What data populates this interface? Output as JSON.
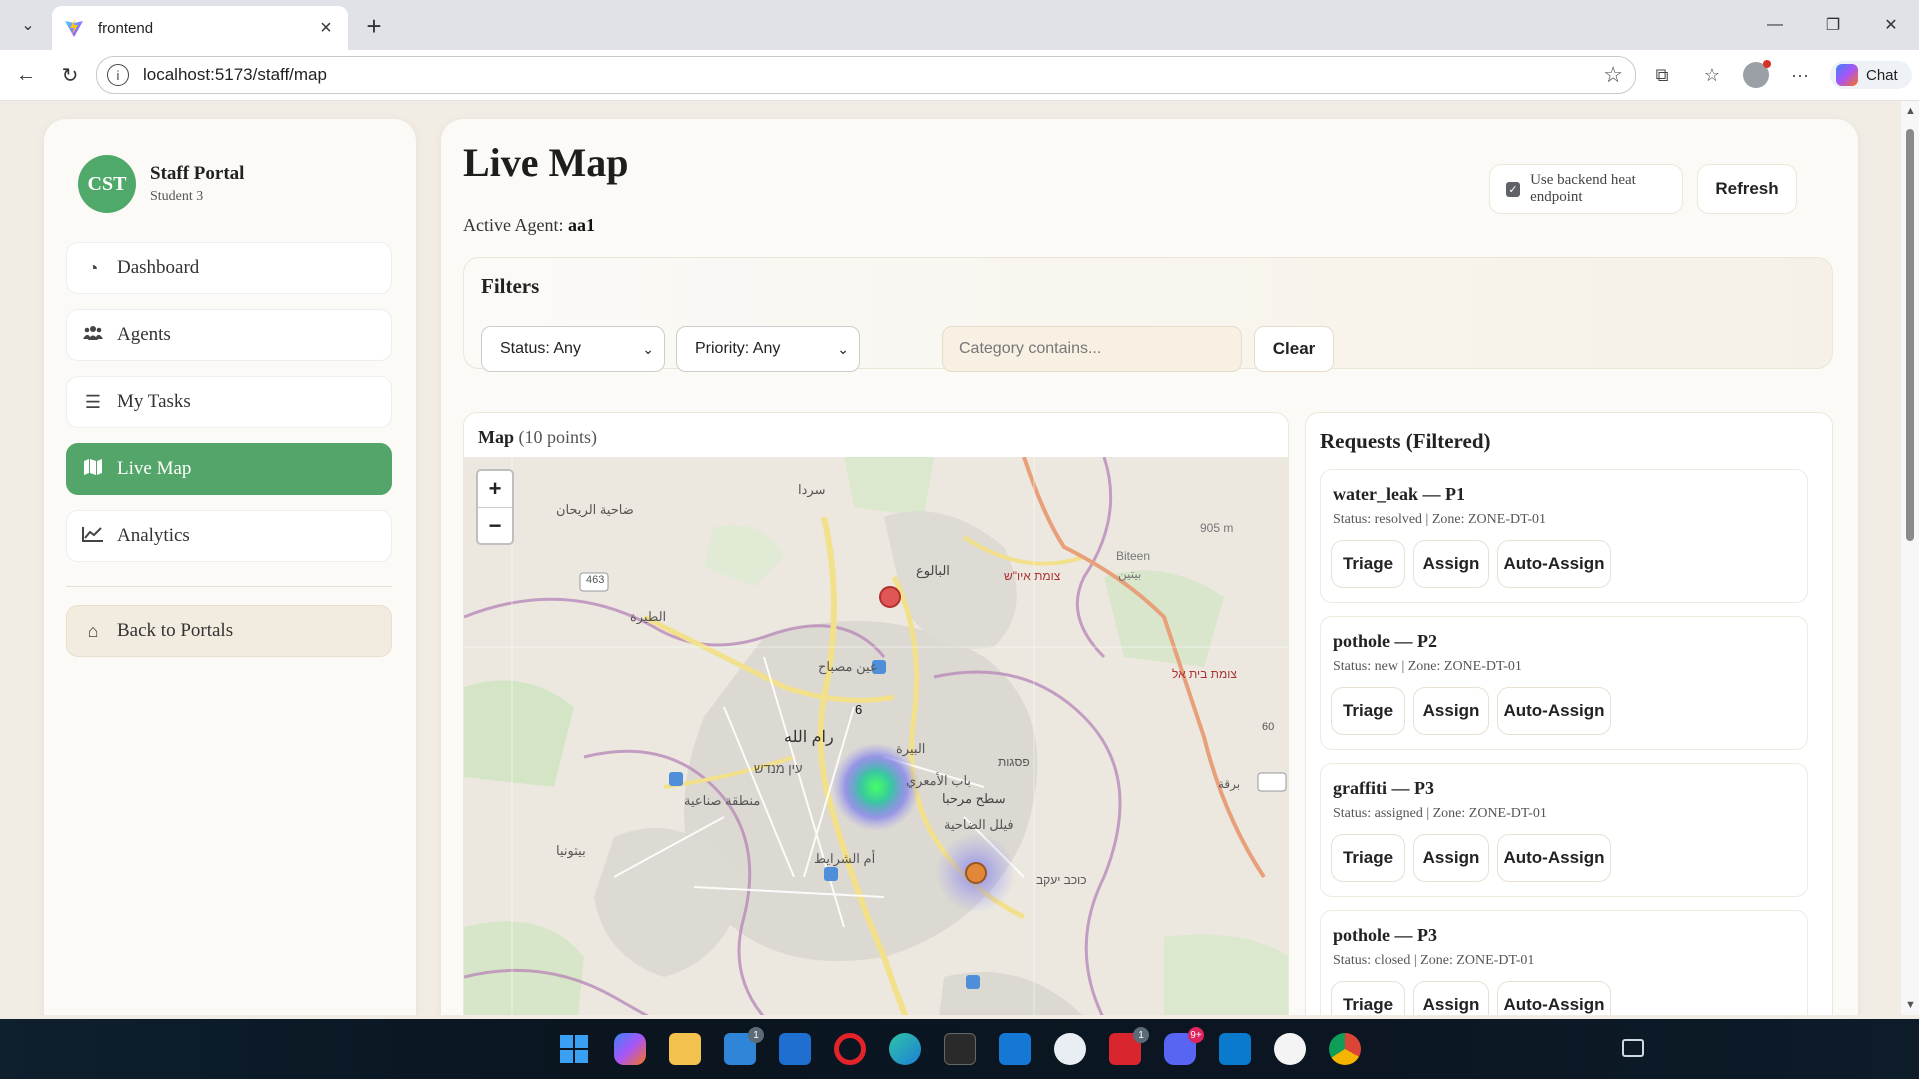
{
  "browser": {
    "tab_title": "frontend",
    "url": "localhost:5173/staff/map",
    "chat_label": "Chat"
  },
  "sidebar": {
    "brand_logo": "CST",
    "brand_title": "Staff Portal",
    "brand_sub": "Student 3",
    "items": [
      {
        "label": "Dashboard",
        "icon": "dashboard-icon"
      },
      {
        "label": "Agents",
        "icon": "users-icon"
      },
      {
        "label": "My Tasks",
        "icon": "list-icon"
      },
      {
        "label": "Live Map",
        "icon": "map-icon",
        "active": true
      },
      {
        "label": "Analytics",
        "icon": "chart-line-icon"
      }
    ],
    "back_label": "Back to Portals"
  },
  "main": {
    "title": "Live Map",
    "agent_label": "Active Agent:",
    "agent_value": "aa1",
    "heat_toggle_label": "Use backend heat endpoint",
    "heat_toggle_checked": true,
    "refresh_label": "Refresh"
  },
  "filters": {
    "title": "Filters",
    "status_value": "Status: Any",
    "priority_value": "Priority: Any",
    "category_placeholder": "Category contains...",
    "clear_label": "Clear"
  },
  "map": {
    "title": "Map",
    "count": "(10 points)",
    "cluster_count": "6",
    "zoom_in": "+",
    "zoom_out": "−",
    "labels": {
      "l1": "سردا",
      "l2": "ضاحية الريحان",
      "l3": "البالوع",
      "l4": "צומת איו\"ש",
      "l5": "Biteen",
      "l6": "بيتين",
      "l7": "905 m",
      "l8": "463",
      "l9": "الطيرة",
      "l10": "عين مصباح",
      "l11": "צומת בית אל",
      "l12": "رام الله",
      "l13": "البيرة",
      "l14": "עין מנדש",
      "l15": "باب الأمعري",
      "l16": "פסגות",
      "l17": "منطقة صناعية",
      "l18": "فيلل الضاحية",
      "l19": "بيتونيا",
      "l20": "أم الشرايط",
      "l21": "כוכב יעקב",
      "l22": "60",
      "l23": "برقة",
      "l24": "سطح مرحبا"
    }
  },
  "requests": {
    "title": "Requests (Filtered)",
    "actions": [
      "Triage",
      "Assign",
      "Auto-Assign"
    ],
    "items": [
      {
        "name": "water_leak — P1",
        "meta": "Status: resolved | Zone: ZONE-DT-01"
      },
      {
        "name": "pothole — P2",
        "meta": "Status: new | Zone: ZONE-DT-01"
      },
      {
        "name": "graffiti — P3",
        "meta": "Status: assigned | Zone: ZONE-DT-01"
      },
      {
        "name": "pothole — P3",
        "meta": "Status: closed | Zone: ZONE-DT-01"
      }
    ]
  },
  "taskbar": {
    "apps": [
      "windows-start-icon",
      "copilot-icon",
      "file-explorer-icon",
      "mail-icon",
      "store-icon",
      "opera-icon",
      "edge-icon",
      "epic-games-icon",
      "outlook-icon",
      "app-icon",
      "l-app-icon",
      "discord-icon",
      "vscode-icon",
      "kaspersky-icon",
      "chrome-icon"
    ],
    "badges": {
      "mail": "1",
      "l_app": "1",
      "discord": "9+"
    }
  }
}
